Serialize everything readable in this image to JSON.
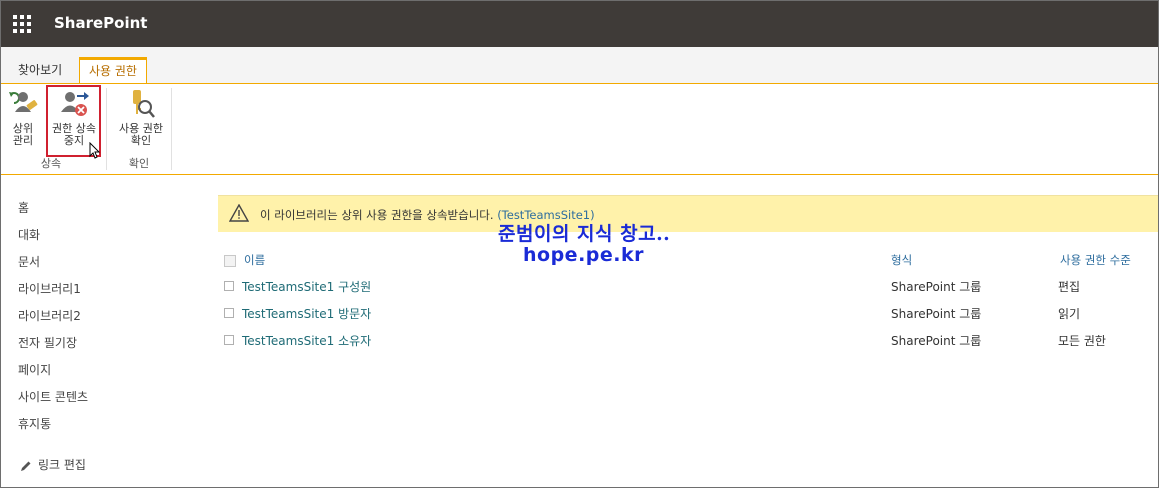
{
  "suite": {
    "brand": "SharePoint",
    "waffle_icon": "app-launcher-icon"
  },
  "tabs": [
    {
      "label": "찾아보기",
      "active": false
    },
    {
      "label": "사용 권한",
      "active": true
    }
  ],
  "ribbon": {
    "groups": [
      {
        "label": "상속",
        "buttons": [
          {
            "label": "상위\n관리",
            "icon": "manage-parent-icon"
          },
          {
            "label": "권한 상속\n중지",
            "icon": "stop-inheriting-icon",
            "highlighted": true
          }
        ]
      },
      {
        "label": "확인",
        "buttons": [
          {
            "label": "사용 권한\n확인",
            "icon": "check-permissions-icon"
          }
        ]
      }
    ]
  },
  "leftnav": {
    "items": [
      "홈",
      "대화",
      "문서",
      "라이브러리1",
      "라이브러리2",
      "전자 필기장",
      "페이지",
      "사이트 콘텐츠",
      "휴지통"
    ],
    "edit_links": "링크 편집"
  },
  "message": {
    "text": "이 라이브러리는 상위 사용 권한을 상속받습니다.",
    "link": "(TestTeamsSite1)"
  },
  "table": {
    "headers": {
      "name": "이름",
      "type": "형식",
      "level": "사용 권한 수준"
    },
    "rows": [
      {
        "name": "TestTeamsSite1 구성원",
        "type": "SharePoint 그룹",
        "level": "편집"
      },
      {
        "name": "TestTeamsSite1 방문자",
        "type": "SharePoint 그룹",
        "level": "읽기"
      },
      {
        "name": "TestTeamsSite1 소유자",
        "type": "SharePoint 그룹",
        "level": "모든 권한"
      }
    ]
  },
  "watermark": {
    "line1": "준범이의 지식 창고..",
    "line2": "hope.pe.kr"
  },
  "colors": {
    "suitebar": "#3f3b38",
    "accent": "#f2a900",
    "link": "#2e6d9e",
    "highlight_border": "#d0202f",
    "message_bg": "#fff2aa"
  }
}
